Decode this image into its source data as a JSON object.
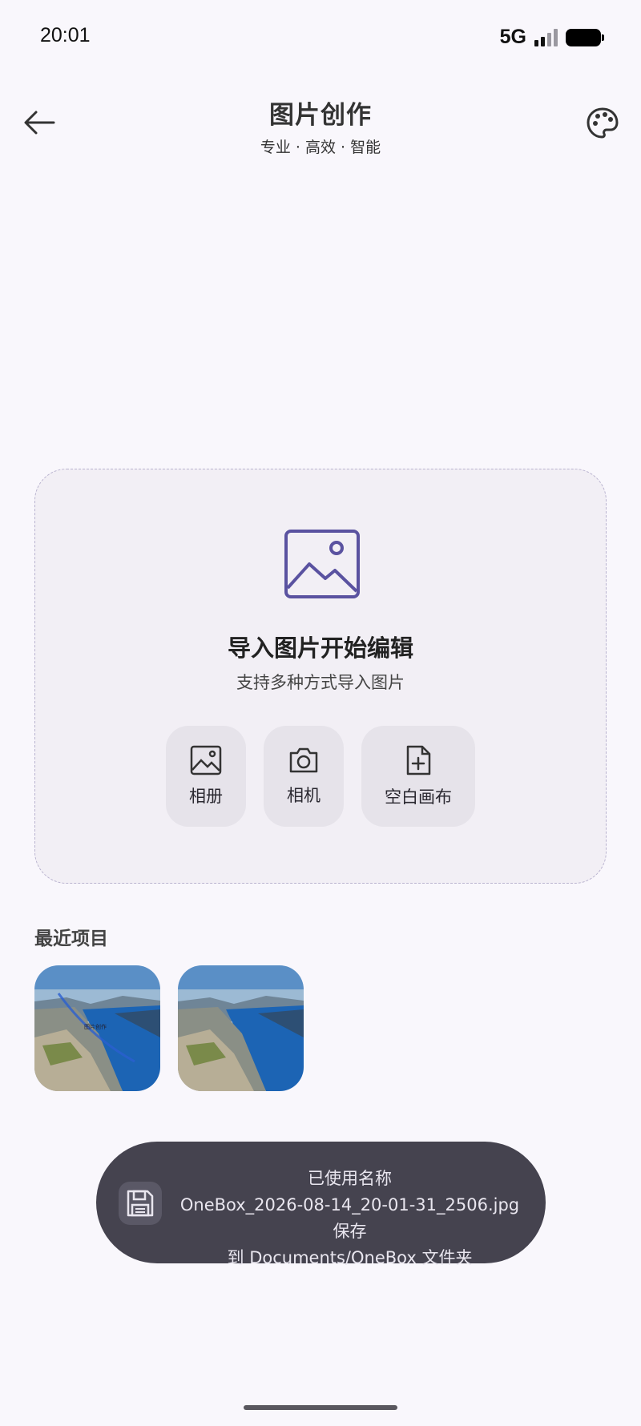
{
  "status_bar": {
    "time": "20:01",
    "network": "5G",
    "signal_bars": 4,
    "signal_active": 2
  },
  "app_bar": {
    "title": "图片创作",
    "subtitle": "专业 · 高效 · 智能",
    "back_icon": "arrow-left-icon",
    "theme_icon": "palette-icon"
  },
  "import_card": {
    "icon": "image-icon",
    "title": "导入图片开始编辑",
    "subtitle": "支持多种方式导入图片",
    "sources": [
      {
        "label": "相册",
        "icon": "gallery-icon"
      },
      {
        "label": "相机",
        "icon": "camera-icon"
      },
      {
        "label": "空白画布",
        "icon": "new-file-icon"
      }
    ]
  },
  "recent": {
    "title": "最近项目",
    "items": [
      {
        "watermark": "图片创作"
      },
      {
        "watermark": ""
      }
    ]
  },
  "toast": {
    "icon": "save-icon",
    "line1": "已使用名称",
    "line2": "OneBox_2026-08-14_20-01-31_2506.jpg 保存",
    "line3": "到 Documents/OneBox 文件夹"
  },
  "colors": {
    "accent": "#5a52a0",
    "background": "#f9f7fc",
    "toast_bg": "#45434f"
  }
}
